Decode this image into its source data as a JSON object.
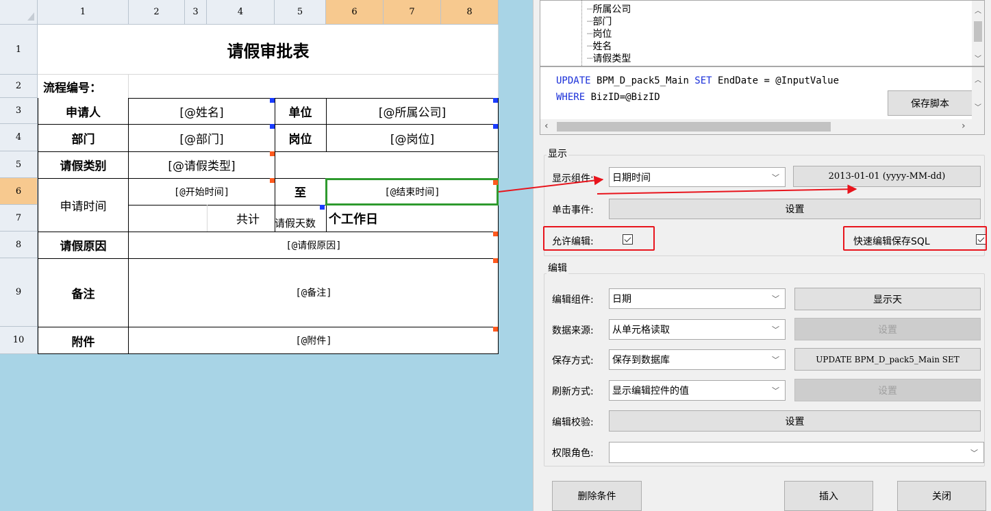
{
  "sheet": {
    "columns": [
      "1",
      "2",
      "3",
      "4",
      "5",
      "6",
      "7",
      "8"
    ],
    "rows": [
      "1",
      "2",
      "3",
      "4",
      "5",
      "6",
      "7",
      "8",
      "9",
      "10"
    ],
    "title": "请假审批表",
    "flow_no_label": "流程编号：",
    "applicant_label": "申请人",
    "applicant_value": "[@姓名]",
    "unit_label": "单位",
    "unit_value": "[@所属公司]",
    "dept_label": "部门",
    "dept_value": "[@部门]",
    "post_label": "岗位",
    "post_value": "[@岗位]",
    "leave_type_label": "请假类别",
    "leave_type_value": "[@请假类型]",
    "apply_time_label": "申请时间",
    "start_value": "[@开始时间]",
    "to_label": "至",
    "end_value": "[@结束时间]",
    "total_label": "共计",
    "days_value": "请假天数",
    "workdays_label": "个工作日",
    "reason_label": "请假原因",
    "reason_value": "[@请假原因]",
    "remark_label": "备注",
    "remark_value": "[@备注]",
    "attach_label": "附件",
    "attach_value": "[@附件]"
  },
  "panel": {
    "tree_items": [
      "所属公司",
      "部门",
      "岗位",
      "姓名",
      "请假类型"
    ],
    "sql_line1_kw1": "UPDATE",
    "sql_line1_mid": " BPM_D_pack5_Main ",
    "sql_line1_kw2": "SET",
    "sql_line1_rest": " EndDate = @InputValue",
    "sql_line2_kw": "WHERE",
    "sql_line2_rest": " BizID=@BizID",
    "save_script_button": "保存脚本",
    "display_group": "显示",
    "display_component_label": "显示组件:",
    "display_component_value": "日期时间",
    "display_format_button": "2013-01-01 (yyyy-MM-dd)",
    "click_event_label": "单击事件:",
    "click_event_button": "设置",
    "allow_edit_label": "允许编辑:",
    "allow_edit_checked": true,
    "quick_save_label": "快速编辑保存SQL",
    "quick_save_checked": true,
    "edit_group": "编辑",
    "edit_component_label": "编辑组件:",
    "edit_component_value": "日期",
    "show_day_button": "显示天",
    "data_source_label": "数据来源:",
    "data_source_value": "从单元格读取",
    "data_source_button": "设置",
    "save_mode_label": "保存方式:",
    "save_mode_value": "保存到数据库",
    "save_mode_button": "UPDATE BPM_D_pack5_Main SET",
    "refresh_mode_label": "刷新方式:",
    "refresh_mode_value": "显示编辑控件的值",
    "refresh_mode_button": "设置",
    "edit_validate_label": "编辑校验:",
    "edit_validate_button": "设置",
    "role_label": "权限角色:",
    "role_value": "",
    "delete_button": "删除条件",
    "insert_button": "插入",
    "close_button": "关闭"
  },
  "colors": {
    "background": "#a8d4e6",
    "selected_header": "#f7c98f",
    "selection_border": "#2e9a2e",
    "annotation_red": "#e8141c",
    "sql_keyword": "#1a2fd9"
  }
}
